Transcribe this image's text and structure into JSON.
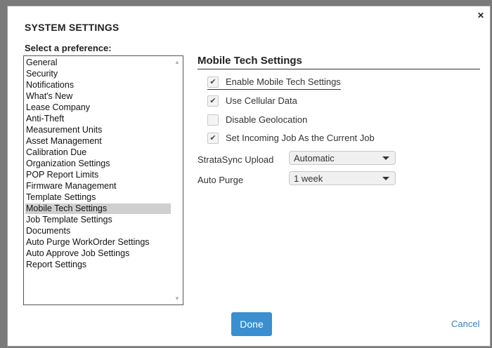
{
  "dialog": {
    "title": "SYSTEM SETTINGS",
    "close_icon": "close-icon"
  },
  "preferences": {
    "label": "Select a preference:",
    "items": [
      "General",
      "Security",
      "Notifications",
      "What's New",
      "Lease Company",
      "Anti-Theft",
      "Measurement Units",
      "Asset Management",
      "Calibration Due",
      "Organization Settings",
      "POP Report Limits",
      "Firmware Management",
      "Template Settings",
      "Mobile Tech Settings",
      "Job Template Settings",
      "Documents",
      "Auto Purge WorkOrder Settings",
      "Auto Approve Job Settings",
      "Report Settings"
    ],
    "selected_index": 13
  },
  "mobile_tech": {
    "heading": "Mobile Tech Settings",
    "options": [
      {
        "label": "Enable Mobile Tech Settings",
        "checked": true
      },
      {
        "label": "Use Cellular Data",
        "checked": true
      },
      {
        "label": "Disable Geolocation",
        "checked": false
      },
      {
        "label": "Set Incoming Job As the Current Job",
        "checked": true
      }
    ],
    "stratasync_upload": {
      "label": "StrataSync Upload",
      "value": "Automatic"
    },
    "auto_purge": {
      "label": "Auto Purge",
      "value": "1 week"
    }
  },
  "footer": {
    "done_label": "Done",
    "cancel_label": "Cancel"
  },
  "colors": {
    "accent": "#3a8fd0",
    "link": "#3a80c0",
    "selected_row": "#cfcfcf"
  }
}
